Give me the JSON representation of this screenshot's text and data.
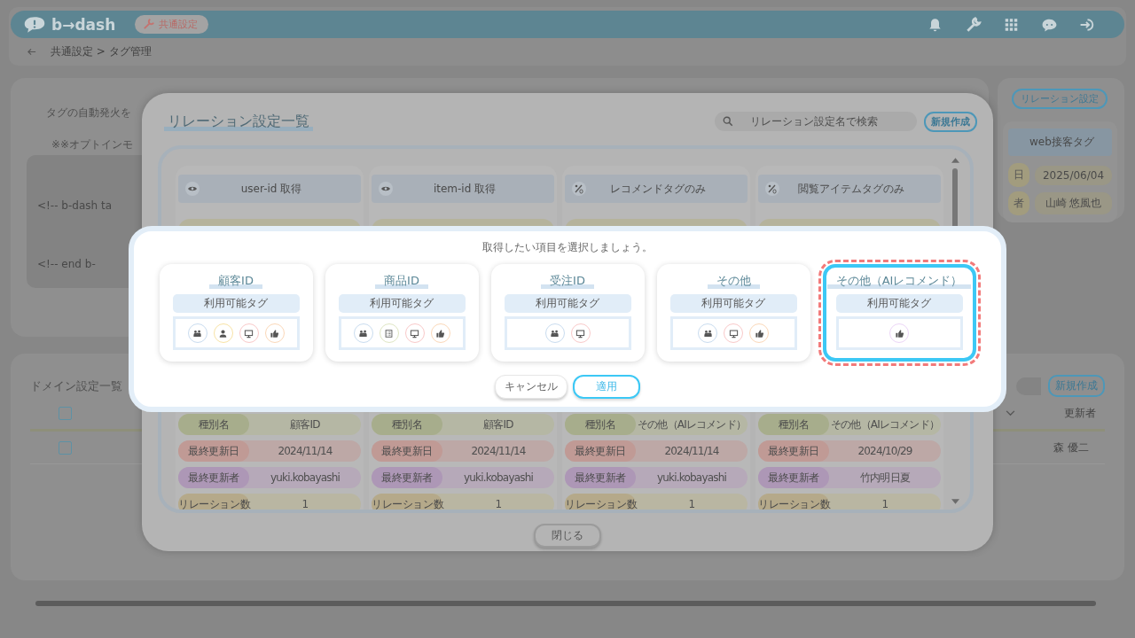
{
  "header": {
    "logo": "b→dash",
    "badge": "共通設定"
  },
  "breadcrumb": {
    "path": "共通設定 > タグ管理"
  },
  "settings_panel": {
    "lines": [
      "タグの自動発火を",
      "※※オプトインモ"
    ],
    "code_lines": [
      "<!-- b-dash ta",
      "<!-- end b-"
    ]
  },
  "tag_panel": {
    "button": "リレーション設定",
    "card": {
      "title": "web接客タグ",
      "rows": [
        {
          "label": "日",
          "value": "2025/06/04"
        },
        {
          "label": "者",
          "value": "山崎 悠風也"
        }
      ]
    }
  },
  "domain_panel": {
    "title": "ドメイン設定一覧",
    "new_button": "新規作成",
    "column": "更新者",
    "header_checked": false,
    "rows": [
      {
        "checked": false,
        "updater": "森 優二"
      }
    ]
  },
  "relation_modal": {
    "title": "リレーション設定一覧",
    "search_placeholder": "リレーション設定名で検索",
    "new_button": "新規作成",
    "cards_top": [
      {
        "kind": "eye",
        "title": "user-id 取得"
      },
      {
        "kind": "eye",
        "title": "item-id 取得"
      },
      {
        "kind": "percent",
        "title": "レコメンドタグのみ"
      },
      {
        "kind": "percent",
        "title": "閲覧アイテムタグのみ"
      }
    ],
    "cards_bottom": [
      {
        "rows": [
          {
            "label": "種別名",
            "value": "顧客ID"
          },
          {
            "label": "最終更新日",
            "value": "2024/11/14"
          },
          {
            "label": "最終更新者",
            "value": "yuki.kobayashi"
          },
          {
            "label": "リレーション数",
            "value": "1"
          }
        ]
      },
      {
        "rows": [
          {
            "label": "種別名",
            "value": "顧客ID"
          },
          {
            "label": "最終更新日",
            "value": "2024/11/14"
          },
          {
            "label": "最終更新者",
            "value": "yuki.kobayashi"
          },
          {
            "label": "リレーション数",
            "value": "1"
          }
        ]
      },
      {
        "rows": [
          {
            "label": "種別名",
            "value": "その他（AIレコメンド）"
          },
          {
            "label": "最終更新日",
            "value": "2024/11/14"
          },
          {
            "label": "最終更新者",
            "value": "yuki.kobayashi"
          },
          {
            "label": "リレーション数",
            "value": "1"
          }
        ]
      },
      {
        "rows": [
          {
            "label": "種別名",
            "value": "その他（AIレコメンド）"
          },
          {
            "label": "最終更新日",
            "value": "2024/10/29"
          },
          {
            "label": "最終更新者",
            "value": "竹内明日夏"
          },
          {
            "label": "リレーション数",
            "value": "1"
          }
        ]
      }
    ],
    "close_button": "閉じる"
  },
  "dialog": {
    "prompt": "取得したい項目を選択しましょう。",
    "options": [
      {
        "title": "顧客ID",
        "tags_label": "利用可能タグ",
        "selected": false,
        "tags": [
          {
            "kind": "group",
            "color": "#c9dcef"
          },
          {
            "kind": "person",
            "color": "#f8e3a6"
          },
          {
            "kind": "monitor",
            "color": "#f9c9c9"
          },
          {
            "kind": "thumb",
            "color": "#fbd8b9"
          }
        ]
      },
      {
        "title": "商品ID",
        "tags_label": "利用可能タグ",
        "selected": false,
        "tags": [
          {
            "kind": "group",
            "color": "#c9dcef"
          },
          {
            "kind": "list",
            "color": "#dfe6c4"
          },
          {
            "kind": "monitor",
            "color": "#f9c9c9"
          },
          {
            "kind": "thumb",
            "color": "#fbd8b9"
          }
        ]
      },
      {
        "title": "受注ID",
        "tags_label": "利用可能タグ",
        "selected": false,
        "tags": [
          {
            "kind": "group",
            "color": "#c9dcef"
          },
          {
            "kind": "monitor",
            "color": "#f9c9c9"
          }
        ]
      },
      {
        "title": "その他",
        "tags_label": "利用可能タグ",
        "selected": false,
        "tags": [
          {
            "kind": "group",
            "color": "#c9dcef"
          },
          {
            "kind": "monitor",
            "color": "#f9c9c9"
          },
          {
            "kind": "thumb",
            "color": "#fbd8b9"
          }
        ]
      },
      {
        "title": "その他（AIレコメンド）",
        "tags_label": "利用可能タグ",
        "selected": true,
        "tags": [
          {
            "kind": "thumb",
            "color": "#ecd6f7"
          }
        ]
      }
    ],
    "cancel_button": "キャンセル",
    "apply_button": "適用"
  }
}
